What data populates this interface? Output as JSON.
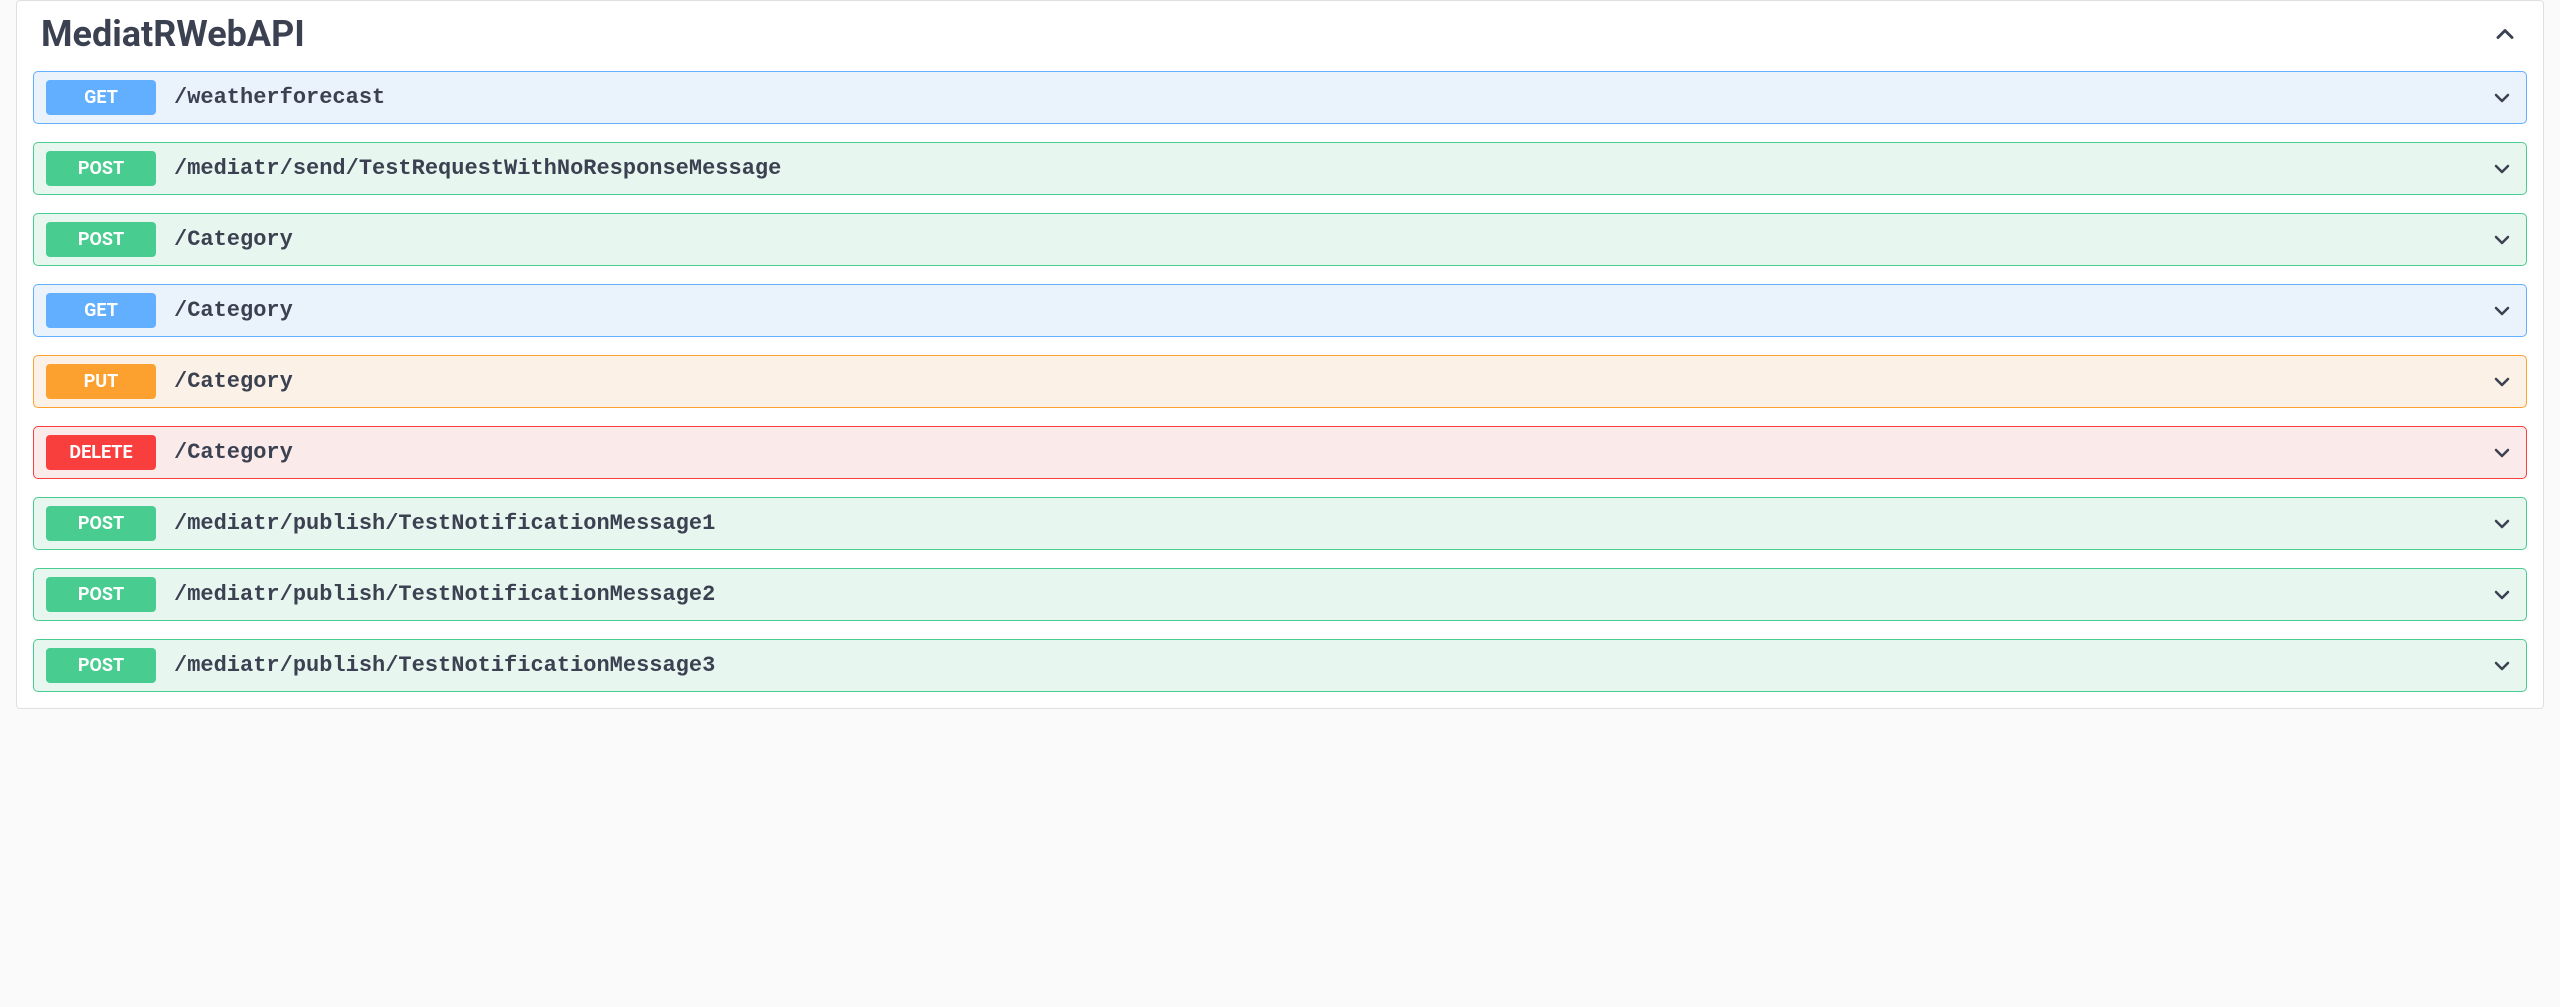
{
  "section": {
    "title": "MediatRWebAPI"
  },
  "operations": [
    {
      "method": "GET",
      "path": "/weatherforecast"
    },
    {
      "method": "POST",
      "path": "/mediatr/send/TestRequestWithNoResponseMessage"
    },
    {
      "method": "POST",
      "path": "/Category"
    },
    {
      "method": "GET",
      "path": "/Category"
    },
    {
      "method": "PUT",
      "path": "/Category"
    },
    {
      "method": "DELETE",
      "path": "/Category"
    },
    {
      "method": "POST",
      "path": "/mediatr/publish/TestNotificationMessage1"
    },
    {
      "method": "POST",
      "path": "/mediatr/publish/TestNotificationMessage2"
    },
    {
      "method": "POST",
      "path": "/mediatr/publish/TestNotificationMessage3"
    }
  ]
}
